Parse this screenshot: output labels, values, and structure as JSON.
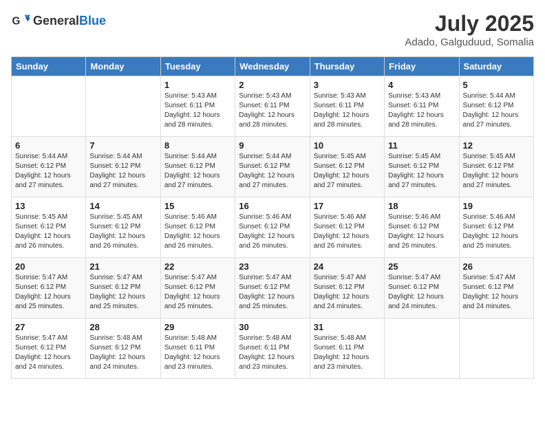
{
  "header": {
    "logo_general": "General",
    "logo_blue": "Blue",
    "month_year": "July 2025",
    "location": "Adado, Galguduud, Somalia"
  },
  "days_of_week": [
    "Sunday",
    "Monday",
    "Tuesday",
    "Wednesday",
    "Thursday",
    "Friday",
    "Saturday"
  ],
  "weeks": [
    [
      {
        "day": "",
        "sunrise": "",
        "sunset": "",
        "daylight": ""
      },
      {
        "day": "",
        "sunrise": "",
        "sunset": "",
        "daylight": ""
      },
      {
        "day": "1",
        "sunrise": "Sunrise: 5:43 AM",
        "sunset": "Sunset: 6:11 PM",
        "daylight": "Daylight: 12 hours and 28 minutes."
      },
      {
        "day": "2",
        "sunrise": "Sunrise: 5:43 AM",
        "sunset": "Sunset: 6:11 PM",
        "daylight": "Daylight: 12 hours and 28 minutes."
      },
      {
        "day": "3",
        "sunrise": "Sunrise: 5:43 AM",
        "sunset": "Sunset: 6:11 PM",
        "daylight": "Daylight: 12 hours and 28 minutes."
      },
      {
        "day": "4",
        "sunrise": "Sunrise: 5:43 AM",
        "sunset": "Sunset: 6:11 PM",
        "daylight": "Daylight: 12 hours and 28 minutes."
      },
      {
        "day": "5",
        "sunrise": "Sunrise: 5:44 AM",
        "sunset": "Sunset: 6:12 PM",
        "daylight": "Daylight: 12 hours and 27 minutes."
      }
    ],
    [
      {
        "day": "6",
        "sunrise": "Sunrise: 5:44 AM",
        "sunset": "Sunset: 6:12 PM",
        "daylight": "Daylight: 12 hours and 27 minutes."
      },
      {
        "day": "7",
        "sunrise": "Sunrise: 5:44 AM",
        "sunset": "Sunset: 6:12 PM",
        "daylight": "Daylight: 12 hours and 27 minutes."
      },
      {
        "day": "8",
        "sunrise": "Sunrise: 5:44 AM",
        "sunset": "Sunset: 6:12 PM",
        "daylight": "Daylight: 12 hours and 27 minutes."
      },
      {
        "day": "9",
        "sunrise": "Sunrise: 5:44 AM",
        "sunset": "Sunset: 6:12 PM",
        "daylight": "Daylight: 12 hours and 27 minutes."
      },
      {
        "day": "10",
        "sunrise": "Sunrise: 5:45 AM",
        "sunset": "Sunset: 6:12 PM",
        "daylight": "Daylight: 12 hours and 27 minutes."
      },
      {
        "day": "11",
        "sunrise": "Sunrise: 5:45 AM",
        "sunset": "Sunset: 6:12 PM",
        "daylight": "Daylight: 12 hours and 27 minutes."
      },
      {
        "day": "12",
        "sunrise": "Sunrise: 5:45 AM",
        "sunset": "Sunset: 6:12 PM",
        "daylight": "Daylight: 12 hours and 27 minutes."
      }
    ],
    [
      {
        "day": "13",
        "sunrise": "Sunrise: 5:45 AM",
        "sunset": "Sunset: 6:12 PM",
        "daylight": "Daylight: 12 hours and 26 minutes."
      },
      {
        "day": "14",
        "sunrise": "Sunrise: 5:45 AM",
        "sunset": "Sunset: 6:12 PM",
        "daylight": "Daylight: 12 hours and 26 minutes."
      },
      {
        "day": "15",
        "sunrise": "Sunrise: 5:46 AM",
        "sunset": "Sunset: 6:12 PM",
        "daylight": "Daylight: 12 hours and 26 minutes."
      },
      {
        "day": "16",
        "sunrise": "Sunrise: 5:46 AM",
        "sunset": "Sunset: 6:12 PM",
        "daylight": "Daylight: 12 hours and 26 minutes."
      },
      {
        "day": "17",
        "sunrise": "Sunrise: 5:46 AM",
        "sunset": "Sunset: 6:12 PM",
        "daylight": "Daylight: 12 hours and 26 minutes."
      },
      {
        "day": "18",
        "sunrise": "Sunrise: 5:46 AM",
        "sunset": "Sunset: 6:12 PM",
        "daylight": "Daylight: 12 hours and 26 minutes."
      },
      {
        "day": "19",
        "sunrise": "Sunrise: 5:46 AM",
        "sunset": "Sunset: 6:12 PM",
        "daylight": "Daylight: 12 hours and 25 minutes."
      }
    ],
    [
      {
        "day": "20",
        "sunrise": "Sunrise: 5:47 AM",
        "sunset": "Sunset: 6:12 PM",
        "daylight": "Daylight: 12 hours and 25 minutes."
      },
      {
        "day": "21",
        "sunrise": "Sunrise: 5:47 AM",
        "sunset": "Sunset: 6:12 PM",
        "daylight": "Daylight: 12 hours and 25 minutes."
      },
      {
        "day": "22",
        "sunrise": "Sunrise: 5:47 AM",
        "sunset": "Sunset: 6:12 PM",
        "daylight": "Daylight: 12 hours and 25 minutes."
      },
      {
        "day": "23",
        "sunrise": "Sunrise: 5:47 AM",
        "sunset": "Sunset: 6:12 PM",
        "daylight": "Daylight: 12 hours and 25 minutes."
      },
      {
        "day": "24",
        "sunrise": "Sunrise: 5:47 AM",
        "sunset": "Sunset: 6:12 PM",
        "daylight": "Daylight: 12 hours and 24 minutes."
      },
      {
        "day": "25",
        "sunrise": "Sunrise: 5:47 AM",
        "sunset": "Sunset: 6:12 PM",
        "daylight": "Daylight: 12 hours and 24 minutes."
      },
      {
        "day": "26",
        "sunrise": "Sunrise: 5:47 AM",
        "sunset": "Sunset: 6:12 PM",
        "daylight": "Daylight: 12 hours and 24 minutes."
      }
    ],
    [
      {
        "day": "27",
        "sunrise": "Sunrise: 5:47 AM",
        "sunset": "Sunset: 6:12 PM",
        "daylight": "Daylight: 12 hours and 24 minutes."
      },
      {
        "day": "28",
        "sunrise": "Sunrise: 5:48 AM",
        "sunset": "Sunset: 6:12 PM",
        "daylight": "Daylight: 12 hours and 24 minutes."
      },
      {
        "day": "29",
        "sunrise": "Sunrise: 5:48 AM",
        "sunset": "Sunset: 6:11 PM",
        "daylight": "Daylight: 12 hours and 23 minutes."
      },
      {
        "day": "30",
        "sunrise": "Sunrise: 5:48 AM",
        "sunset": "Sunset: 6:11 PM",
        "daylight": "Daylight: 12 hours and 23 minutes."
      },
      {
        "day": "31",
        "sunrise": "Sunrise: 5:48 AM",
        "sunset": "Sunset: 6:11 PM",
        "daylight": "Daylight: 12 hours and 23 minutes."
      },
      {
        "day": "",
        "sunrise": "",
        "sunset": "",
        "daylight": ""
      },
      {
        "day": "",
        "sunrise": "",
        "sunset": "",
        "daylight": ""
      }
    ]
  ]
}
